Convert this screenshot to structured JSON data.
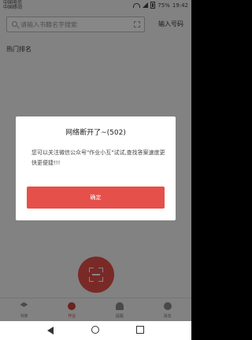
{
  "status_bar": {
    "carrier_line1": "中国电信",
    "carrier_line2": "中国移动",
    "battery": "75%",
    "time": "19:42"
  },
  "search": {
    "placeholder": "请输入书籍名字搜索",
    "enter_homework": "输入号码"
  },
  "section": {
    "title": "热门排名"
  },
  "dialog": {
    "title": "网络断开了~(502)",
    "message": "您可以关注微信公众号\"作业小互\"试试,查找答案速度更快更便捷!!!",
    "button": "确定"
  },
  "tabs": [
    {
      "label": "书架"
    },
    {
      "label": "作业"
    },
    {
      "label": "提醒"
    },
    {
      "label": "消息"
    }
  ],
  "colors": {
    "accent": "#e5504b",
    "overlay": "rgba(0,0,0,0.47)"
  },
  "icons": {
    "fab": "scan-icon",
    "tabs": [
      "bookshelf-icon",
      "homework-icon",
      "bell-icon",
      "message-icon"
    ]
  }
}
